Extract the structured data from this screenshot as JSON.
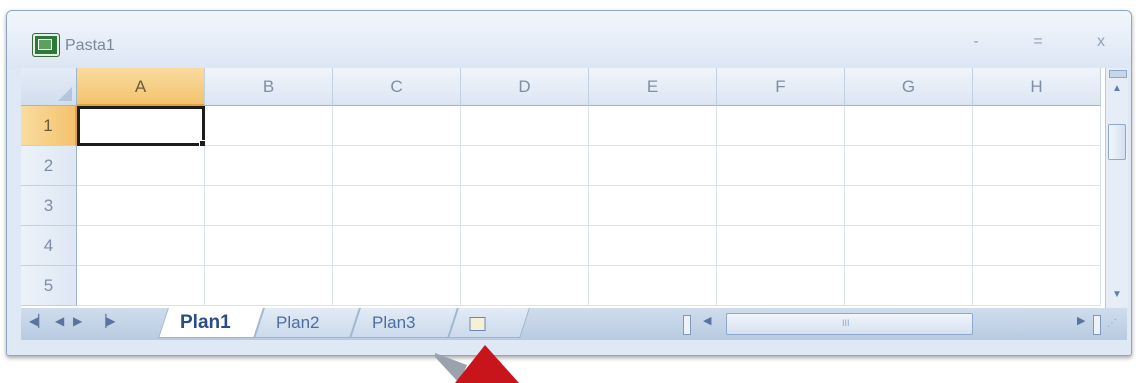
{
  "window": {
    "title": "Pasta1",
    "controls": {
      "minimize": "-",
      "maximize": "=",
      "close": "x"
    }
  },
  "grid": {
    "columns": [
      "A",
      "B",
      "C",
      "D",
      "E",
      "F",
      "G",
      "H"
    ],
    "rows": [
      "1",
      "2",
      "3",
      "4",
      "5"
    ],
    "selected_cell": "A1"
  },
  "sheets": {
    "tabs": [
      "Plan1",
      "Plan2",
      "Plan3"
    ],
    "active": "Plan1",
    "new_sheet_icon": "insert-worksheet-icon"
  },
  "hscroll": {
    "grip": "III"
  },
  "colors": {
    "selection_header": "#f4c26e",
    "header_bg": "#dbe5f2",
    "callout": "#c8141b"
  }
}
